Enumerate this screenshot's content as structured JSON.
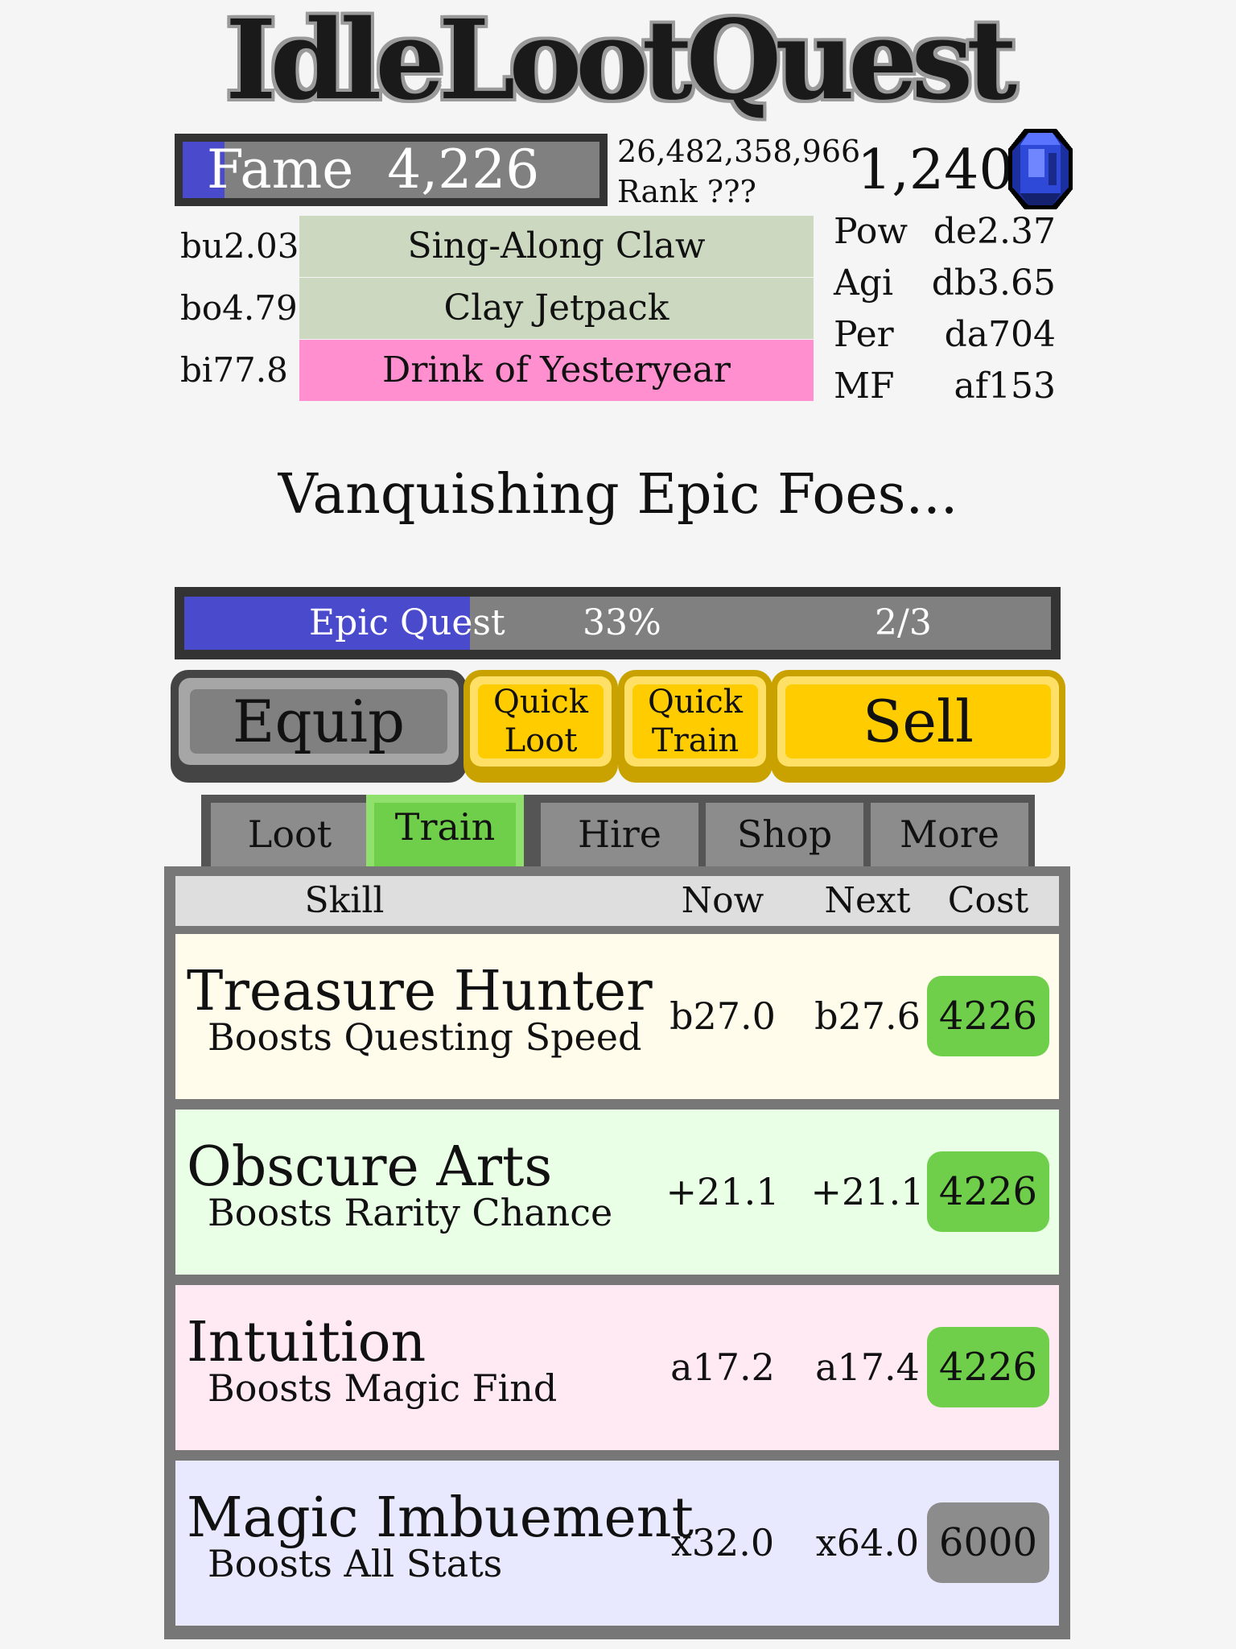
{
  "app": {
    "title": "IdleLootQuest"
  },
  "header": {
    "fame_label": "Fame",
    "fame_value": "4,226",
    "fame_progress": 0.1,
    "gold": "26,482,358,966",
    "rank": "Rank ???",
    "gems": "1,240",
    "gem_icon": "blue-gem-icon"
  },
  "equipment": [
    {
      "tier": "bu2.03",
      "name": "Sing-Along Claw",
      "color": "#ccd9c0"
    },
    {
      "tier": "bo4.79",
      "name": "Clay Jetpack",
      "color": "#ccd9c0"
    },
    {
      "tier": "bi77.8",
      "name": "Drink of Yesteryear",
      "color": "#ff8fcf"
    }
  ],
  "stats": [
    {
      "name": "Pow",
      "value": "de2.37"
    },
    {
      "name": "Agi",
      "value": "db3.65"
    },
    {
      "name": "Per",
      "value": "da704"
    },
    {
      "name": "MF",
      "value": "af153"
    }
  ],
  "status_text": "Vanquishing Epic Foes...",
  "quest": {
    "label": "Epic Quest",
    "percent": "33%",
    "progress": 0.33,
    "count": "2/3"
  },
  "actions": {
    "equip": "Equip",
    "quick_loot_1": "Quick",
    "quick_loot_2": "Loot",
    "quick_train_1": "Quick",
    "quick_train_2": "Train",
    "sell": "Sell"
  },
  "tabs": [
    "Loot",
    "Train",
    "Hire",
    "Shop",
    "More"
  ],
  "active_tab": "Train",
  "table": {
    "headers": {
      "skill": "Skill",
      "now": "Now",
      "next": "Next",
      "cost": "Cost"
    },
    "rows": [
      {
        "name": "Treasure Hunter",
        "desc": "Boosts Questing Speed",
        "now": "b27.0",
        "next": "b27.6",
        "cost": "4226",
        "bg": "#fffceb",
        "cost_color": "#6fcf4a"
      },
      {
        "name": "Obscure Arts",
        "desc": "Boosts Rarity Chance",
        "now": "+21.1",
        "next": "+21.1",
        "cost": "4226",
        "bg": "#e9ffe6",
        "cost_color": "#6fcf4a"
      },
      {
        "name": "Intuition",
        "desc": "Boosts Magic Find",
        "now": "a17.2",
        "next": "a17.4",
        "cost": "4226",
        "bg": "#ffe9f2",
        "cost_color": "#6fcf4a"
      },
      {
        "name": "Magic Imbuement",
        "desc": "Boosts All Stats",
        "now": "x32.0",
        "next": "x64.0",
        "cost": "6000",
        "bg": "#e8e9ff",
        "cost_color": "#8c8c8c"
      }
    ]
  }
}
